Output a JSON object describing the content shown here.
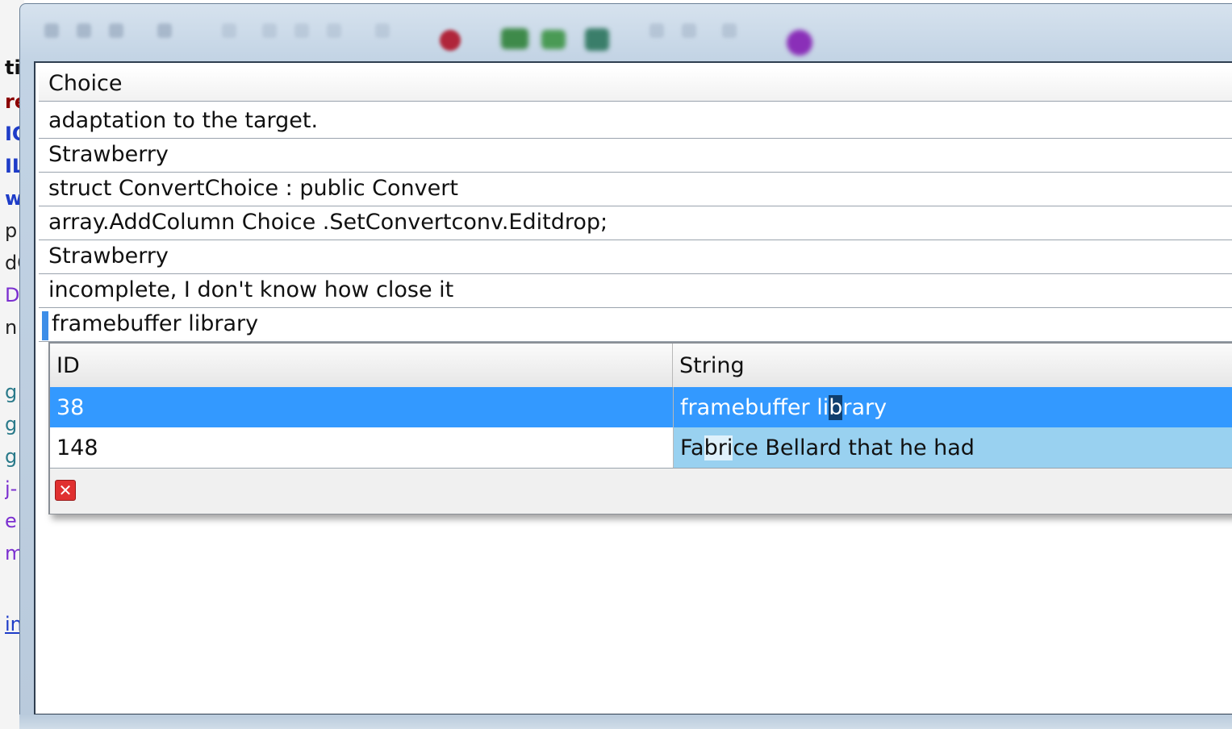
{
  "background_editor": {
    "lines": [
      {
        "text": "ti",
        "color": "#111111"
      },
      {
        "text": "re",
        "color": "#8b0000"
      },
      {
        "text": "IC",
        "color": "#1e3cc8"
      },
      {
        "text": "IL",
        "color": "#1e3cc8"
      },
      {
        "text": "w",
        "color": "#1e3cc8"
      },
      {
        "text": "p",
        "color": "#222222"
      },
      {
        "text": "dC",
        "color": "#222222"
      },
      {
        "text": "D",
        "color": "#7b2fd0"
      },
      {
        "text": "n",
        "color": "#222222"
      },
      {
        "text": "g",
        "color": "#2a7a8a"
      },
      {
        "text": "g",
        "color": "#2a7a8a"
      },
      {
        "text": "g",
        "color": "#2a7a8a"
      },
      {
        "text": "j-",
        "color": "#7b2fd0"
      },
      {
        "text": "e",
        "color": "#7b2fd0"
      },
      {
        "text": "m",
        "color": "#7b2fd0"
      },
      {
        "text": "in",
        "color": "#1e3cc8"
      }
    ]
  },
  "list": {
    "header": "Choice",
    "rows": [
      "adaptation to the target.",
      "Strawberry",
      "struct ConvertChoice : public Convert",
      "array.AddColumn Choice .SetConvertconv.Editdrop;",
      "Strawberry",
      "incomplete, I don't know how close it"
    ],
    "editing_value": "framebuffer library"
  },
  "dropdown": {
    "columns": [
      "ID",
      "String"
    ],
    "selected_row": {
      "id": "38",
      "string_parts": [
        "framebuffer li",
        "b",
        "rary"
      ]
    },
    "second_row": {
      "id": "148",
      "string_parts": [
        "Fa",
        "bri",
        "ce Bellard that he had"
      ]
    },
    "close_icon": "close-icon"
  },
  "colors": {
    "selection": "#3399ff",
    "alt_cell": "#99d1f0",
    "close_red": "#e03030"
  }
}
